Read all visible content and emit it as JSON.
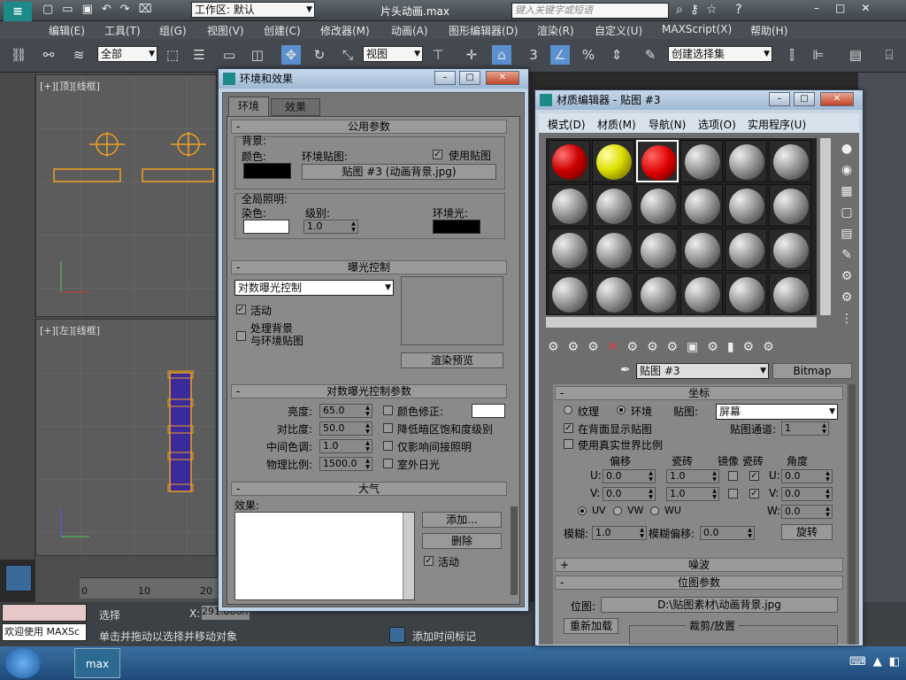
{
  "app": {
    "file_title": "片头动画.max",
    "workspace": "工作区: 默认",
    "search_placeholder": "键入关键字或短语"
  },
  "menu": [
    "编辑(E)",
    "工具(T)",
    "组(G)",
    "视图(V)",
    "创建(C)",
    "修改器(M)",
    "动画(A)",
    "图形编辑器(D)",
    "渲染(R)",
    "自定义(U)",
    "MAXScript(X)",
    "帮助(H)"
  ],
  "toolbar": {
    "filter": "全部",
    "refcoord": "视图",
    "selset": "创建选择集",
    "snap_angle": "3"
  },
  "viewports": {
    "top": "[+][顶][线框]",
    "left": "[+][左][线框]"
  },
  "env": {
    "title": "环境和效果",
    "tabs": [
      "环境",
      "效果"
    ],
    "common": {
      "header": "公用参数",
      "bg_label": "背景:",
      "color_label": "颜色:",
      "envmap_label": "环境贴图:",
      "use_map": "使用贴图",
      "map_button": "贴图 #3 (动画背景.jpg)",
      "gi_label": "全局照明:",
      "tint_label": "染色:",
      "level_label": "级别:",
      "level_value": "1.0",
      "ambient_label": "环境光:"
    },
    "exposure": {
      "header": "曝光控制",
      "type": "对数曝光控制",
      "active": "活动",
      "process_bg": "处理背景",
      "process_bg2": "与环境贴图",
      "render_preview": "渲染预览"
    },
    "logparams": {
      "header": "对数曝光控制参数",
      "brightness_label": "亮度:",
      "brightness": "65.0",
      "contrast_label": "对比度:",
      "contrast": "50.0",
      "midtones_label": "中间色调:",
      "midtones": "1.0",
      "physcale_label": "物理比例:",
      "physcale": "1500.0",
      "color_correction": "颜色修正:",
      "desat": "降低暗区饱和度级别",
      "affect_indirect": "仅影响间接照明",
      "exterior": "室外日光"
    },
    "atmos": {
      "header": "大气",
      "effects_label": "效果:",
      "add": "添加...",
      "delete": "删除",
      "active": "活动"
    }
  },
  "mat": {
    "title": "材质编辑器 - 贴图 #3",
    "menu": [
      "模式(D)",
      "材质(M)",
      "导航(N)",
      "选项(O)",
      "实用程序(U)"
    ],
    "map_name": "贴图 #3",
    "map_type": "Bitmap",
    "coords": {
      "header": "坐标",
      "texture": "纹理",
      "environ": "环境",
      "mapping_label": "贴图:",
      "mapping": "屏幕",
      "show_back": "在背面显示贴图",
      "map_channel_label": "贴图通道:",
      "map_channel": "1",
      "real_world": "使用真实世界比例",
      "offset": "偏移",
      "tiling": "瓷砖",
      "mirror": "镜像",
      "tile": "瓷砖",
      "angle": "角度",
      "u": "U:",
      "v": "V:",
      "w": "W:",
      "u_off": "0.0",
      "v_off": "0.0",
      "u_tile": "1.0",
      "v_tile": "1.0",
      "u_ang": "0.0",
      "v_ang": "0.0",
      "w_ang": "0.0",
      "uv": "UV",
      "vw": "VW",
      "wu": "WU",
      "blur_label": "模糊:",
      "blur": "1.0",
      "bluroff_label": "模糊偏移:",
      "bluroff": "0.0",
      "rotate": "旋转"
    },
    "noise": "噪波",
    "bitmap": {
      "header": "位图参数",
      "bitmap_label": "位图:",
      "path": "D:\\贴图素材\\动画背景.jpg",
      "reload": "重新加载",
      "crop": "裁剪/放置"
    }
  },
  "status": {
    "welcome": "欢迎使用 MAXSc",
    "selected": "选择",
    "hint": "单击并拖动以选择并移动对象",
    "add_time_tag": "添加时间标记",
    "x_label": "X:",
    "x_value": "291.886mm",
    "track_labels": [
      "10",
      "20"
    ],
    "ruler_zero": "0"
  }
}
